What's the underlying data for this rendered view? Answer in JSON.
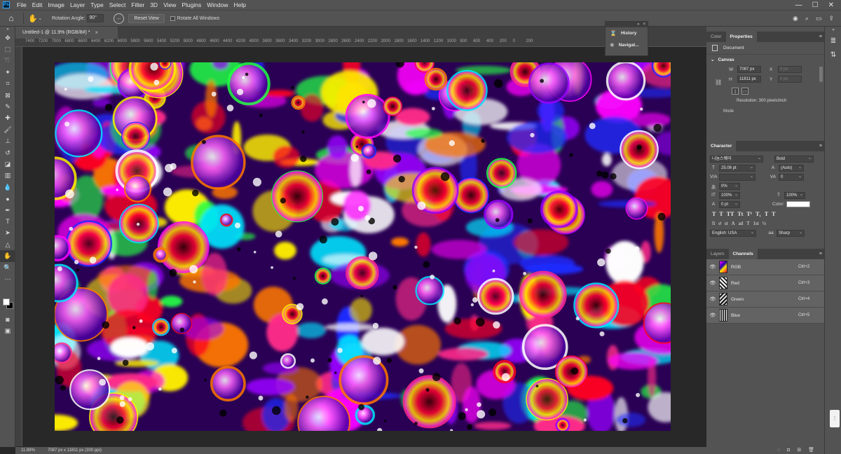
{
  "app": {
    "logo": "Ps",
    "menu": [
      "File",
      "Edit",
      "Image",
      "Layer",
      "Type",
      "Select",
      "Filter",
      "3D",
      "View",
      "Plugins",
      "Window",
      "Help"
    ],
    "window_controls": {
      "minimize": "—",
      "maximize": "☐",
      "close": "✕"
    }
  },
  "options_bar": {
    "rotation_label": "Rotation Angle:",
    "rotation_value": "90°",
    "reset_view": "Reset View",
    "rotate_all": "Rotate All Windows"
  },
  "document": {
    "tab_title": "Untitled-1 @ 11.9% (RGB/8#) *",
    "tab_close": "×",
    "ruler_ticks": [
      "7400",
      "7200",
      "7000",
      "6800",
      "6600",
      "6400",
      "6200",
      "6000",
      "5800",
      "5600",
      "5400",
      "5200",
      "5000",
      "4800",
      "4600",
      "4400",
      "4200",
      "4000",
      "3800",
      "3600",
      "3400",
      "3200",
      "3000",
      "2800",
      "2600",
      "2400",
      "2200",
      "2000",
      "1800",
      "1600",
      "1400",
      "1200",
      "1000",
      "800",
      "600",
      "400",
      "200",
      "0",
      "200"
    ]
  },
  "status": {
    "zoom": "11.89%",
    "info": "7087 px x 11811 px (300 ppi)"
  },
  "mini_panel": {
    "items": [
      {
        "label": "History",
        "icon": "history-icon"
      },
      {
        "label": "Navigat...",
        "icon": "navigator-icon"
      }
    ]
  },
  "properties": {
    "tabs": [
      "Color",
      "Properties"
    ],
    "active_tab": "Properties",
    "document_label": "Document",
    "canvas_label": "Canvas",
    "width_label": "W",
    "width_value": "7087 px",
    "x_label": "X",
    "x_value": "0 px",
    "height_label": "H",
    "height_value": "11811 px",
    "y_label": "Y",
    "y_value": "0 px",
    "resolution": "Resolution: 300 pixels/inch",
    "mode_label": "Mode"
  },
  "character": {
    "tab": "Character",
    "font_family": "나눔스퀘어",
    "font_style": "Bold",
    "font_size": "25.06 pt",
    "leading": "(Auto)",
    "kerning": "",
    "tracking": "0",
    "scale_pct": "0%",
    "vertical_scale": "100%",
    "horizontal_scale": "100%",
    "baseline": "0 pt",
    "color_label": "Color:",
    "style_buttons": [
      "T",
      "T",
      "TT",
      "Tt",
      "T¹",
      "T₁",
      "T",
      "T"
    ],
    "opentype_buttons": [
      "fi",
      "ơ",
      "st",
      "A",
      "ad",
      "T",
      "1st",
      "½"
    ],
    "language": "English: USA",
    "aa_icon": "aa",
    "antialias": "Sharp"
  },
  "channels": {
    "tabs": [
      "Layers",
      "Channels"
    ],
    "active_tab": "Channels",
    "rows": [
      {
        "name": "RGB",
        "shortcut": "Ctrl+2"
      },
      {
        "name": "Red",
        "shortcut": "Ctrl+3"
      },
      {
        "name": "Green",
        "shortcut": "Ctrl+4"
      },
      {
        "name": "Blue",
        "shortcut": "Ctrl+5"
      }
    ]
  },
  "colors": {
    "ui_dark": "#535353",
    "ui_darker": "#404040",
    "workspace": "#282828",
    "foreground": "#ffffff",
    "background": "#000000"
  }
}
